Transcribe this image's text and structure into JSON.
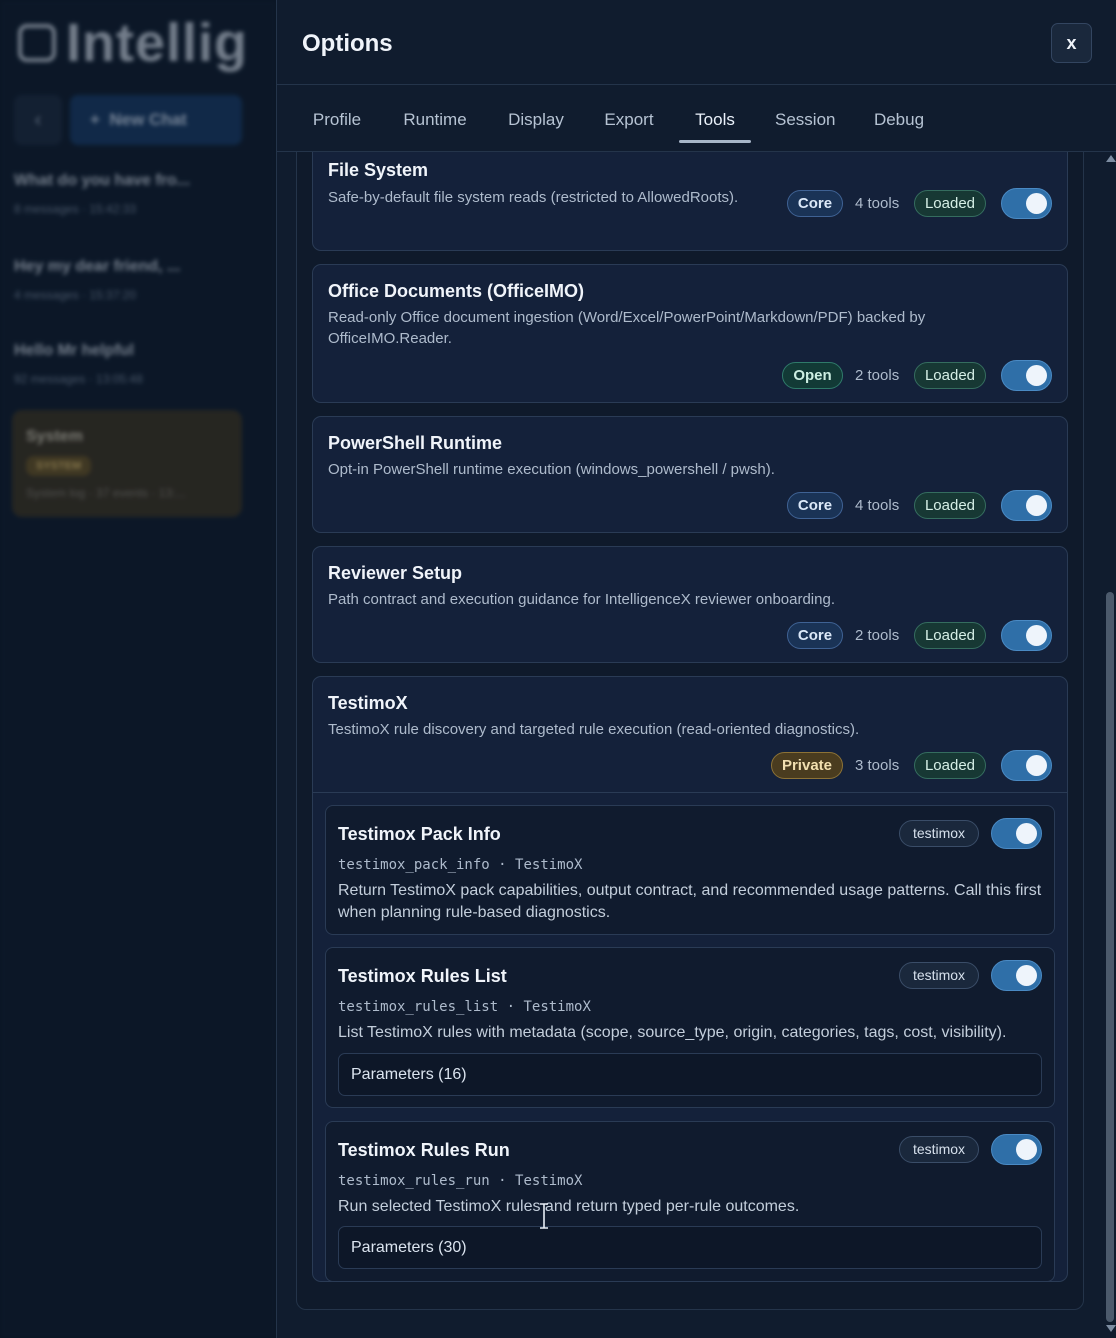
{
  "background": {
    "app_name": "Intellig",
    "new_chat_label": "New Chat",
    "chats": [
      {
        "title": "What do you have fro...",
        "meta": "8 messages · 15:42:33"
      },
      {
        "title": "Hey my dear friend, ...",
        "meta": "4 messages · 15:37:20"
      },
      {
        "title": "Hello Mr helpful",
        "meta": "92 messages · 13:05:48"
      }
    ],
    "system_chat": {
      "title": "System",
      "badge": "SYSTEM",
      "meta": "System log · 37 events · 13:..."
    }
  },
  "modal": {
    "title": "Options",
    "close_label": "x",
    "tabs": [
      {
        "label": "Profile"
      },
      {
        "label": "Runtime"
      },
      {
        "label": "Display"
      },
      {
        "label": "Export"
      },
      {
        "label": "Tools",
        "active": true
      },
      {
        "label": "Session"
      },
      {
        "label": "Debug"
      }
    ]
  },
  "packs": [
    {
      "name": "File System",
      "description": "Safe-by-default file system reads (restricted to AllowedRoots).",
      "tier": "Core",
      "tool_count": "4 tools",
      "status": "Loaded",
      "enabled": true
    },
    {
      "name": "Office Documents (OfficeIMO)",
      "description": "Read-only Office document ingestion (Word/Excel/PowerPoint/Markdown/PDF) backed by OfficeIMO.Reader.",
      "tier": "Open",
      "tool_count": "2 tools",
      "status": "Loaded",
      "enabled": true
    },
    {
      "name": "PowerShell Runtime",
      "description": "Opt-in PowerShell runtime execution (windows_powershell / pwsh).",
      "tier": "Core",
      "tool_count": "4 tools",
      "status": "Loaded",
      "enabled": true
    },
    {
      "name": "Reviewer Setup",
      "description": "Path contract and execution guidance for IntelligenceX reviewer onboarding.",
      "tier": "Core",
      "tool_count": "2 tools",
      "status": "Loaded",
      "enabled": true
    },
    {
      "name": "TestimoX",
      "description": "TestimoX rule discovery and targeted rule execution (read-oriented diagnostics).",
      "tier": "Private",
      "tool_count": "3 tools",
      "status": "Loaded",
      "enabled": true
    }
  ],
  "tools": [
    {
      "title": "Testimox Pack Info",
      "id": "testimox_pack_info",
      "pack": "TestimoX",
      "separator": "·",
      "tag": "testimox",
      "enabled": true,
      "description": "Return TestimoX pack capabilities, output contract, and recommended usage patterns. Call this first when planning rule-based diagnostics.",
      "params_label": ""
    },
    {
      "title": "Testimox Rules List",
      "id": "testimox_rules_list",
      "pack": "TestimoX",
      "separator": "·",
      "tag": "testimox",
      "enabled": true,
      "description": "List TestimoX rules with metadata (scope, source_type, origin, categories, tags, cost, visibility).",
      "params_label": "Parameters (16)"
    },
    {
      "title": "Testimox Rules Run",
      "id": "testimox_rules_run",
      "pack": "TestimoX",
      "separator": "·",
      "tag": "testimox",
      "enabled": true,
      "description": "Run selected TestimoX rules and return typed per-rule outcomes.",
      "params_label": "Parameters (30)"
    }
  ],
  "colors": {
    "accent": "#2f6fa8",
    "core": "#3f6294",
    "open": "#2f7a6a",
    "private": "#8c7236",
    "loaded": "#356d5f"
  }
}
